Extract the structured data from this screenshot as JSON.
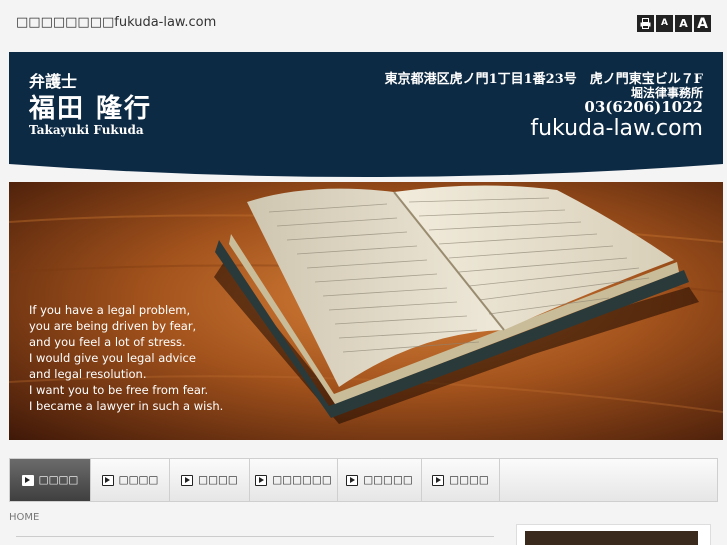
{
  "site": {
    "title_prefix": "□□□□□□□□",
    "title_domain": "fukuda-law.com"
  },
  "font_tools": {
    "print": "print-icon",
    "small": "A",
    "medium": "A",
    "large": "A"
  },
  "header": {
    "role": "弁護士",
    "name": "福田 隆行",
    "name_roman": "Takayuki Fukuda",
    "address": "東京都港区虎ノ門1丁目1番23号　虎ノ門東宝ビル７F",
    "office": "堀法律事務所",
    "phone": "03(6206)1022",
    "domain": "fukuda-law.com",
    "colors": {
      "banner": "#0d2a44",
      "text": "#ffffff"
    }
  },
  "hero": {
    "lines": [
      "If you have a legal problem,",
      "you are being driven by fear,",
      "and you feel a lot of stress.",
      "I would give you legal advice",
      "and legal resolution.",
      "I want you to be free from fear.",
      "I became a lawyer in such a wish."
    ]
  },
  "nav": {
    "items": [
      {
        "label": "□□□□",
        "active": true
      },
      {
        "label": "□□□□",
        "active": false
      },
      {
        "label": "□□□□",
        "active": false
      },
      {
        "label": "□□□□□□",
        "active": false
      },
      {
        "label": "□□□□□",
        "active": false
      },
      {
        "label": "□□□□",
        "active": false
      }
    ]
  },
  "breadcrumb": {
    "home": "HOME"
  }
}
